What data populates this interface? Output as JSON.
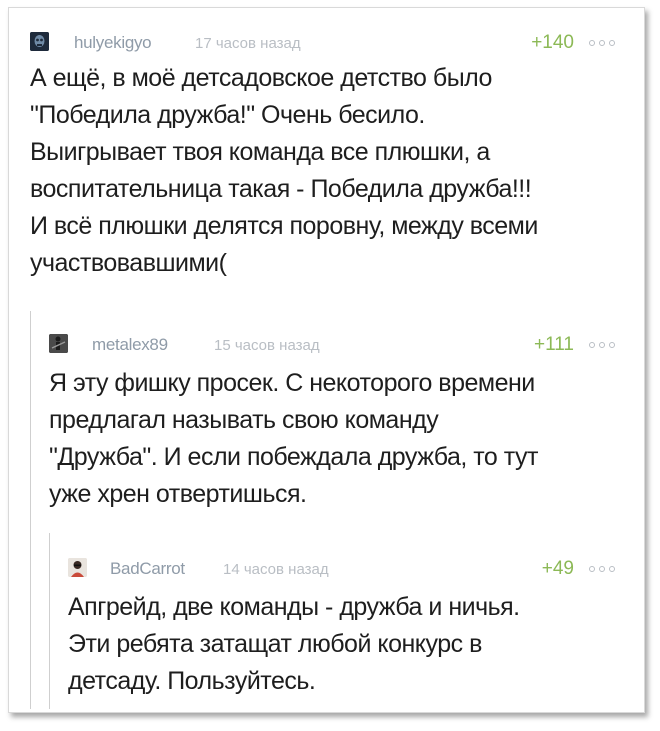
{
  "comments": [
    {
      "username": "hulyekigyo",
      "time": "17 часов назад",
      "rating": "+140",
      "text": "А ещё, в моё детсадовское детство было\n\"Победила дружба!\" Очень бесило.\nВыигрывает твоя команда все плюшки, а\nвоспитательница такая - Победила дружба!!!\nИ всё плюшки делятся поровну, между всеми\nучаствовавшими(",
      "avatar_icon": "skull-avatar-icon",
      "avatar_color": "#24344a"
    },
    {
      "username": "metalex89",
      "time": "15 часов назад",
      "rating": "+111",
      "text": "Я эту фишку просек. С некоторого времени\nпредлагал называть свою команду\n\"Дружба\". И если побеждала дружба, то тут\nуже хрен отвертишься.",
      "avatar_icon": "guitarist-avatar-icon",
      "avatar_color": "#3a3a3a"
    },
    {
      "username": "BadCarrot",
      "time": "14 часов назад",
      "rating": "+49",
      "text": "Апгрейд, две команды - дружба и ничья.\nЭти ребята затащат любой конкурс в\nдетсаду. Пользуйтесь.",
      "avatar_icon": "person-avatar-icon",
      "avatar_color": "#c94a3a"
    }
  ],
  "colors": {
    "username": "#8f9ba8",
    "time": "#b9bec4",
    "rating": "#8cb956",
    "text": "#1e1e1e"
  }
}
